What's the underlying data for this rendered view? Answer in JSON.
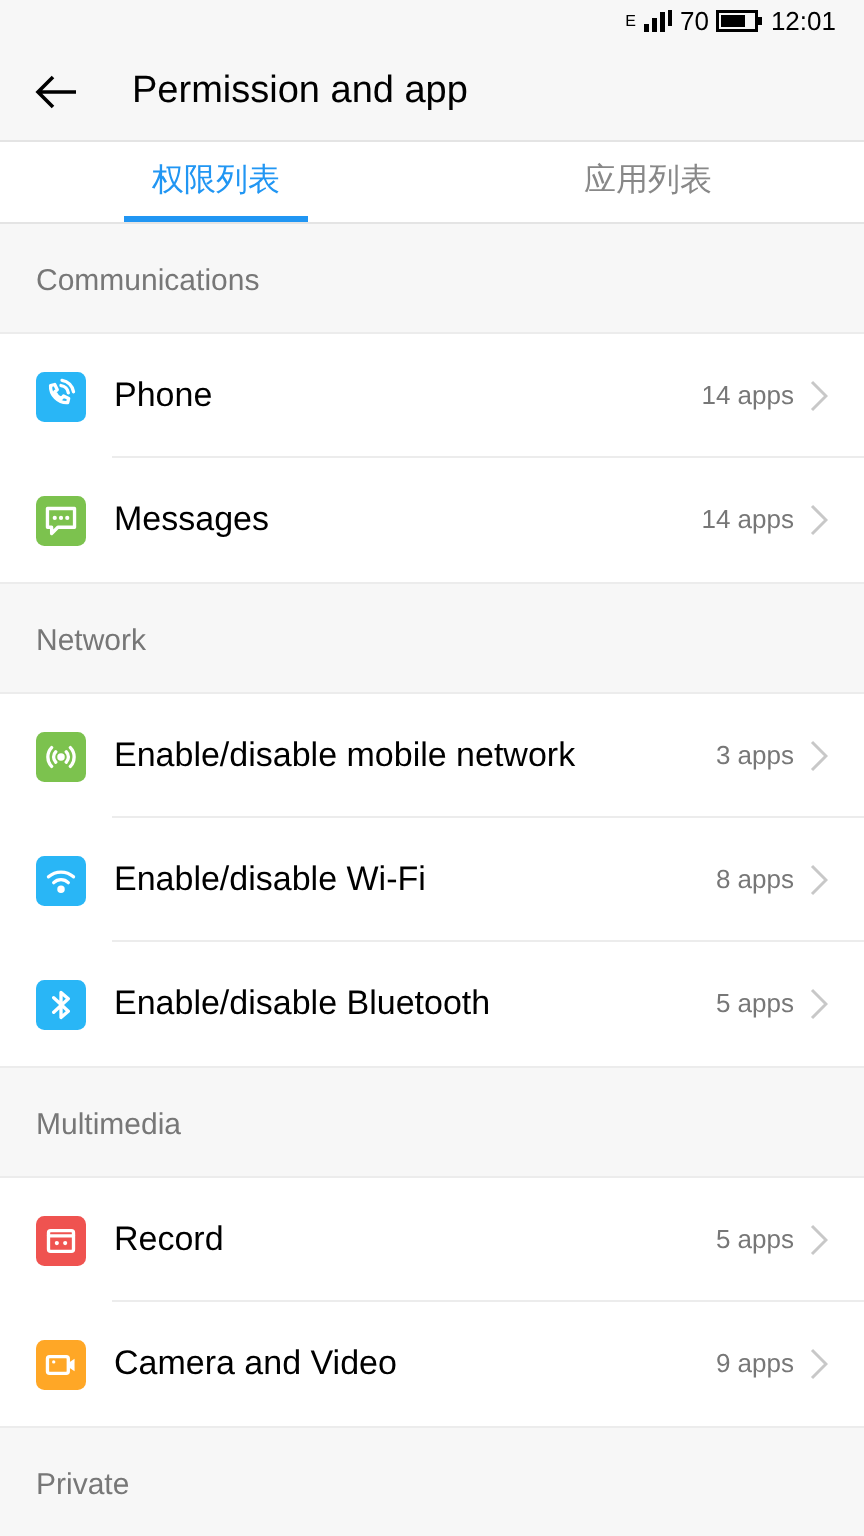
{
  "status_bar": {
    "network": "E",
    "battery": "70",
    "time": "12:01"
  },
  "header": {
    "title": "Permission and app"
  },
  "tabs": [
    {
      "label": "权限列表",
      "selected": true
    },
    {
      "label": "应用列表",
      "selected": false
    }
  ],
  "sections": [
    {
      "title": "Communications",
      "items": [
        {
          "label": "Phone",
          "count": "14 apps",
          "kind": "phone",
          "color": "#29b6f6"
        },
        {
          "label": "Messages",
          "count": "14 apps",
          "kind": "message",
          "color": "#7cc24e"
        }
      ]
    },
    {
      "title": "Network",
      "items": [
        {
          "label": "Enable/disable mobile network",
          "count": "3 apps",
          "kind": "antenna",
          "color": "#7cc24e"
        },
        {
          "label": "Enable/disable Wi-Fi",
          "count": "8 apps",
          "kind": "wifi",
          "color": "#29b6f6"
        },
        {
          "label": "Enable/disable Bluetooth",
          "count": "5 apps",
          "kind": "bluetooth",
          "color": "#29b6f6"
        }
      ]
    },
    {
      "title": "Multimedia",
      "items": [
        {
          "label": "Record",
          "count": "5 apps",
          "kind": "record",
          "color": "#ef5350"
        },
        {
          "label": "Camera and Video",
          "count": "9 apps",
          "kind": "video",
          "color": "#ffa726"
        }
      ]
    },
    {
      "title": "Private"
    }
  ]
}
